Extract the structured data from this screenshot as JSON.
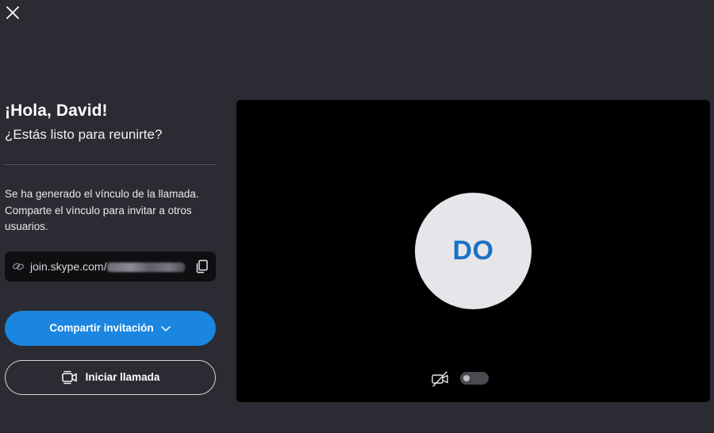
{
  "icons": {
    "close": "close-icon",
    "link": "link-icon",
    "copy": "copy-icon",
    "chevron": "chevron-down-icon",
    "video": "video-call-icon",
    "camera_off": "camera-off-icon"
  },
  "colors": {
    "background": "#2b2c33",
    "accent": "#1a86e0",
    "preview": "#000000",
    "avatar_bg": "#e6e6ea",
    "avatar_text": "#1a72c4"
  },
  "welcome": {
    "greeting": "¡Hola, David!",
    "subtitle": "¿Estás listo para reunirte?"
  },
  "info": {
    "text": "Se ha generado el vínculo de la llamada. Comparte el vínculo para invitar a otros usuarios."
  },
  "link": {
    "prefix": "join.skype.com/"
  },
  "actions": {
    "share_label": "Compartir invitación",
    "start_call_label": "Iniciar llamada"
  },
  "preview": {
    "initials": "DO",
    "camera_enabled": false
  }
}
